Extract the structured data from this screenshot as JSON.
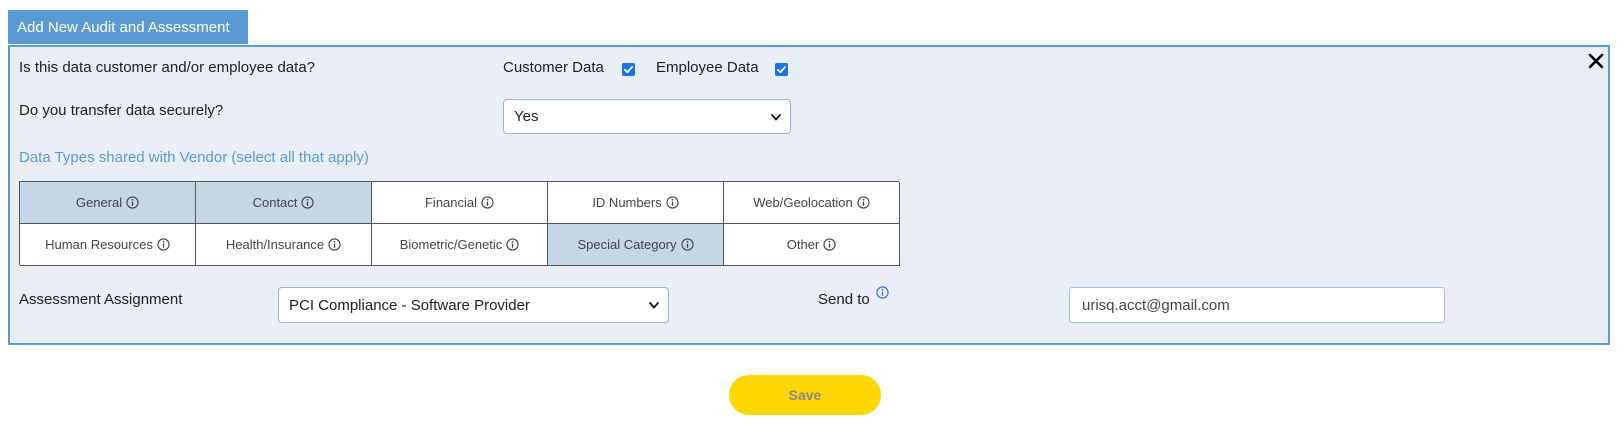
{
  "header": {
    "tab_title": "Add New Audit and Assessment"
  },
  "form": {
    "q1": {
      "text": "Is this data customer and/or employee data?",
      "customer_label": "Customer Data",
      "customer_checked": true,
      "employee_label": "Employee Data",
      "employee_checked": true
    },
    "q2": {
      "text": "Do you transfer data securely?",
      "selected": "Yes"
    },
    "data_types": {
      "title": "Data Types shared with Vendor (select all that apply)",
      "items": [
        {
          "label": "General",
          "selected": true
        },
        {
          "label": "Contact",
          "selected": true
        },
        {
          "label": "Financial",
          "selected": false
        },
        {
          "label": "ID Numbers",
          "selected": false
        },
        {
          "label": "Web/Geolocation",
          "selected": false
        },
        {
          "label": "Human Resources",
          "selected": false
        },
        {
          "label": "Health/Insurance",
          "selected": false
        },
        {
          "label": "Biometric/Genetic",
          "selected": false
        },
        {
          "label": "Special Category",
          "selected": true
        },
        {
          "label": "Other",
          "selected": false
        }
      ]
    },
    "assignment": {
      "label": "Assessment Assignment",
      "selected": "PCI Compliance - Software Provider"
    },
    "send_to": {
      "label": "Send to",
      "value": "urisq.acct@gmail.com"
    }
  },
  "actions": {
    "save_label": "Save"
  },
  "colors": {
    "accent": "#5b9bd5",
    "panel_bg": "#e8eef4",
    "selected_cell": "#c5d6e6",
    "save_bg": "#ffd600",
    "checkbox": "#1a73e8"
  },
  "icons": {
    "close": "close-icon",
    "info": "info-icon",
    "dropdown": "chevron-down-icon",
    "check": "checkmark-icon"
  }
}
